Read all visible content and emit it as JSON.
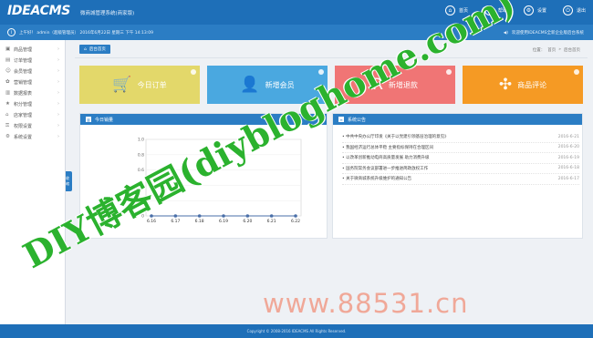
{
  "header": {
    "logo": "IDEACMS",
    "subtitle": "微商城管理系统(商家版)",
    "nav": [
      {
        "label": "首页",
        "icon": "home-icon",
        "glyph": "⌂"
      },
      {
        "label": "帮助",
        "icon": "help-icon",
        "glyph": "?"
      },
      {
        "label": "设置",
        "icon": "settings-icon",
        "glyph": "⚙"
      },
      {
        "label": "退出",
        "icon": "power-icon",
        "glyph": "⏻"
      }
    ]
  },
  "infobar": {
    "welcome": "上午好！ admin（超级管理员）  2016年6月22日  星期三  下午  14:13:09",
    "notice": "欢迎使用IDEACMS全新企业版后台系统"
  },
  "sidebar": {
    "items": [
      {
        "label": "商品管理",
        "glyph": "▣"
      },
      {
        "label": "订单管理",
        "glyph": "▤"
      },
      {
        "label": "会员管理",
        "glyph": "☺"
      },
      {
        "label": "营销管理",
        "glyph": "✿"
      },
      {
        "label": "数据报表",
        "glyph": "▥"
      },
      {
        "label": "积分管理",
        "glyph": "★"
      },
      {
        "label": "店家管理",
        "glyph": "⌂"
      },
      {
        "label": "权限设置",
        "glyph": "⚿"
      },
      {
        "label": "系统设置",
        "glyph": "⚙"
      }
    ],
    "toggle": "收缩"
  },
  "topbar": {
    "home_tab": "后台首页",
    "breadcrumb": [
      "位置：",
      "首页",
      "»",
      "后台首页"
    ]
  },
  "cards": [
    {
      "label": "今日订单",
      "icon": "cart-icon",
      "glyph": "🛒",
      "color": "#e3d86a"
    },
    {
      "label": "新增会员",
      "icon": "user-icon",
      "glyph": "👤",
      "color": "#4aa8e0"
    },
    {
      "label": "新增退款",
      "icon": "refund-icon",
      "glyph": "R",
      "color": "#f07575"
    },
    {
      "label": "商品评论",
      "icon": "comment-icon",
      "glyph": "✣",
      "color": "#f59a24"
    }
  ],
  "panels": {
    "left_title": "今日销量",
    "right_title": "系统公告"
  },
  "news": [
    {
      "title": "中共中央办公厅印发《关于以党建引领基层治理的意见》",
      "date": "2016-6-21"
    },
    {
      "title": "我国经济运行总体平稳 主要指标保持在合理区间",
      "date": "2016-6-20"
    },
    {
      "title": "以改革创新推动电商高质量发展 助力消费升级",
      "date": "2016-6-19"
    },
    {
      "title": "国务院常务会议部署进一步推进简政放权工作",
      "date": "2016-6-18"
    },
    {
      "title": "关于微商城系统升级维护的通知公告",
      "date": "2016-6-17"
    }
  ],
  "chart_data": {
    "type": "line",
    "categories": [
      "6.16",
      "6.17",
      "6.18",
      "6.19",
      "6.20",
      "6.21",
      "6.22"
    ],
    "series": [
      {
        "values": [
          0,
          0,
          0,
          0,
          0,
          0,
          0
        ]
      }
    ],
    "yticks": [
      "1.0",
      "0.8",
      "0.6",
      "0.4",
      "0.2",
      "0"
    ],
    "ylim": [
      0,
      1
    ],
    "color": "#4a6fa8"
  },
  "footer": "Copyright © 2008-2016 IDEACMS All Rights Reserved.",
  "watermark": {
    "text1": "DIY博客园(diybloghome.com)",
    "text2": "www.88531.cn"
  }
}
